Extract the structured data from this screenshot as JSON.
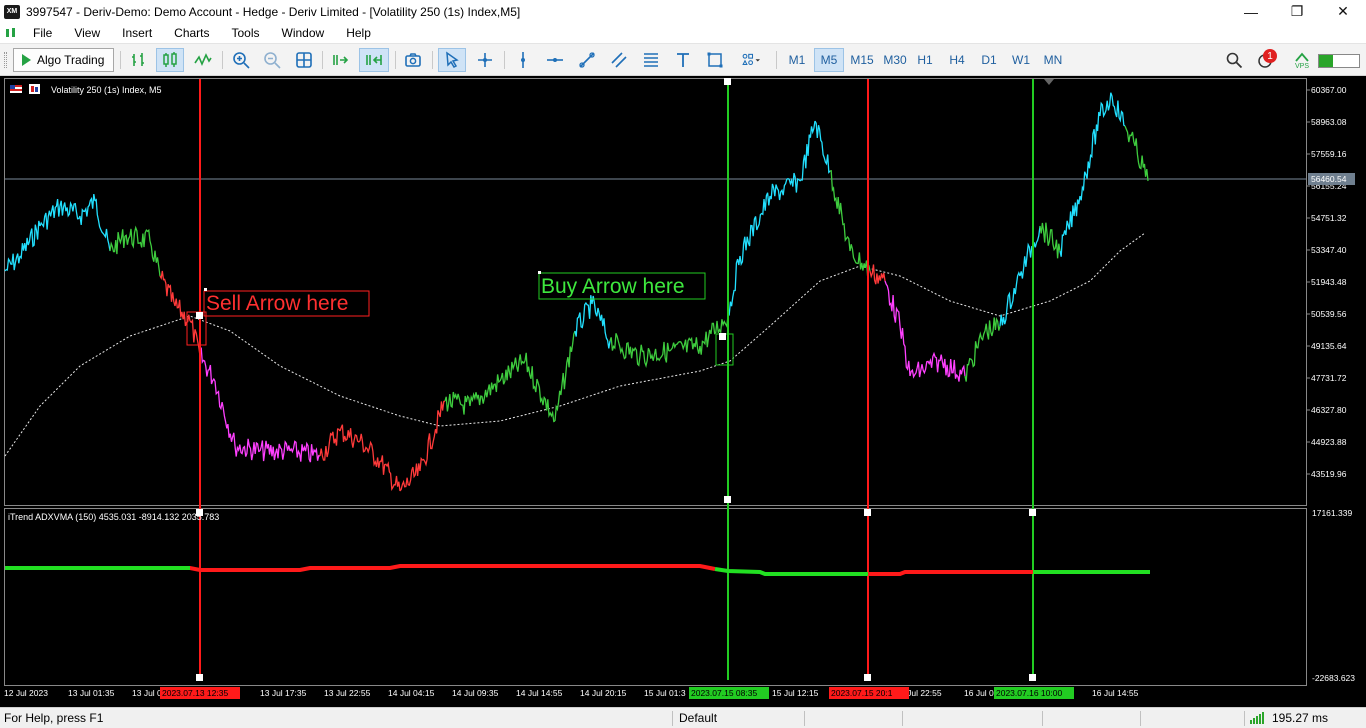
{
  "window": {
    "title": "3997547 - Deriv-Demo: Demo Account - Hedge - Deriv Limited - [Volatility 250 (1s) Index,M5]",
    "app_icon_text": "XM",
    "minimize": "—",
    "restore": "❐",
    "close": "✕"
  },
  "menu": [
    "File",
    "View",
    "Insert",
    "Charts",
    "Tools",
    "Window",
    "Help"
  ],
  "toolbar": {
    "algo_trading_label": "Algo Trading",
    "timeframes": [
      "M1",
      "M5",
      "M15",
      "M30",
      "H1",
      "H4",
      "D1",
      "W1",
      "MN"
    ],
    "active_timeframe": "M5",
    "notification_count": "1",
    "vps_label": "VPS"
  },
  "chart": {
    "title": "Volatility 250 (1s) Index, M5",
    "price_labels": [
      "60367.00",
      "58963.08",
      "57559.16",
      "56155.24",
      "54751.32",
      "53347.40",
      "51943.48",
      "50539.56",
      "49135.64",
      "47731.72",
      "46327.80",
      "44923.88",
      "43519.96"
    ],
    "current_price": "56460.54",
    "sell_annotation": "Sell Arrow here",
    "buy_annotation": "Buy Arrow here",
    "indicator_title": "iTrend ADXVMA (150) 4535.031 -8914.132 2035.783",
    "indicator_top_label": "17161.339",
    "indicator_bottom_label": "-22683.623",
    "time_labels": [
      "12 Jul 2023",
      "13 Jul 01:35",
      "13 Jul 0",
      "13 Jul 17:35",
      "13 Jul 22:55",
      "14 Jul 04:15",
      "14 Jul 09:35",
      "14 Jul 14:55",
      "14 Jul 20:15",
      "15 Jul 01:3",
      "15 Jul 12:15",
      "5 Jul 22:55",
      "16 Jul 0",
      "16 Jul 14:55"
    ],
    "vline_labels": [
      "2023.07.13 12:35",
      "2023.07.15 08:35",
      "2023.07.15 20:1",
      "2023.07.16 10:00"
    ],
    "colors": {
      "sell_line": "#ff1a1a",
      "buy_line": "#22cc22",
      "up_strong": "#22e0ff",
      "up": "#3ecc3e",
      "down": "#ff3a3a",
      "down_strong": "#ff40ff",
      "ma": "#e8e8e8"
    }
  },
  "status": {
    "help": "For Help, press F1",
    "profile": "Default",
    "ping": "195.27 ms"
  }
}
